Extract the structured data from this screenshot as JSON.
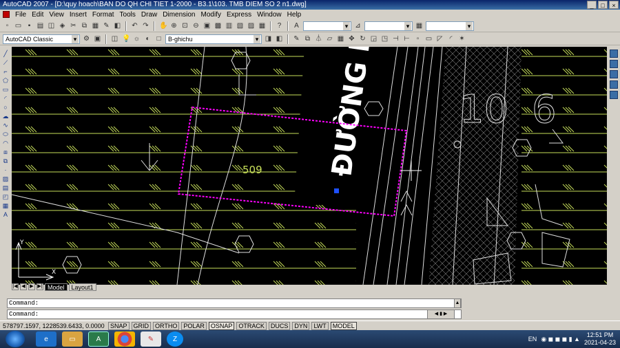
{
  "window": {
    "title": "AutoCAD 2007 - [D:\\quy hoach\\BAN DO QH CHI TIET 1-2000 - B3.1\\103. TMB DIEM SO 2 n1.dwg]",
    "minimize": "_",
    "maximize": "□",
    "close": "×"
  },
  "menu": [
    "File",
    "Edit",
    "View",
    "Insert",
    "Format",
    "Tools",
    "Draw",
    "Dimension",
    "Modify",
    "Express",
    "Window",
    "Help"
  ],
  "toolbar": {
    "workspace": "AutoCAD Classic",
    "layer": "B-ghichu"
  },
  "drawing": {
    "lot_number": "509",
    "road_label": "ĐƯỜNG N",
    "number_a": "10",
    "number_b": "6",
    "colors": {
      "background": "#000000",
      "hatch": "#c8e05a",
      "selection": "#ff00ff",
      "lines": "#e0e0e0"
    }
  },
  "layout_tabs": {
    "model": "Model",
    "layout1": "Layout1"
  },
  "command": {
    "line1": "Command:",
    "line2": "Command:"
  },
  "status": {
    "coords": "578797.1597, 1228539.6433, 0.0000",
    "buttons": [
      "SNAP",
      "GRID",
      "ORTHO",
      "POLAR",
      "OSNAP",
      "OTRACK",
      "DUCS",
      "DYN",
      "LWT",
      "MODEL"
    ]
  },
  "taskbar": {
    "language": "EN",
    "time": "12:51 PM",
    "date": "2021-04-23",
    "apps": [
      "windows-start",
      "internet-explorer",
      "file-explorer",
      "autocad",
      "chrome",
      "paint",
      "zalo"
    ]
  }
}
